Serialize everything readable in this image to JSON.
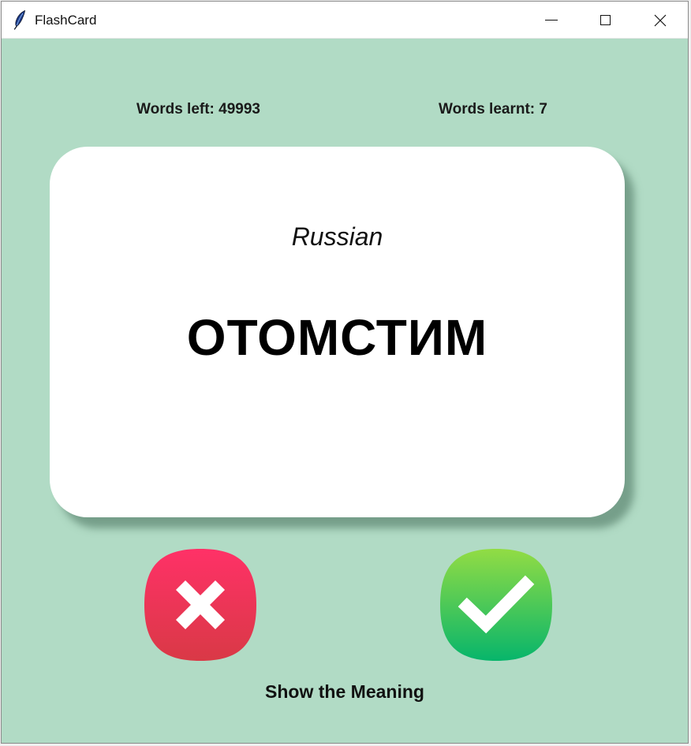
{
  "window": {
    "title": "FlashCard",
    "app_icon": "feather-icon"
  },
  "stats": {
    "words_left": "Words left: 49993",
    "words_learnt": "Words learnt: 7"
  },
  "card": {
    "language": "Russian",
    "word": "ОТОМСТИМ"
  },
  "buttons": {
    "wrong_icon": "cross-icon",
    "right_icon": "checkmark-icon",
    "show_meaning": "Show the Meaning"
  },
  "colors": {
    "background": "#b1dbc5",
    "card": "#ffffff",
    "wrong_top": "#ff3167",
    "wrong_bottom": "#d93946",
    "right_top": "#92dc44",
    "right_bottom": "#07b56b"
  }
}
